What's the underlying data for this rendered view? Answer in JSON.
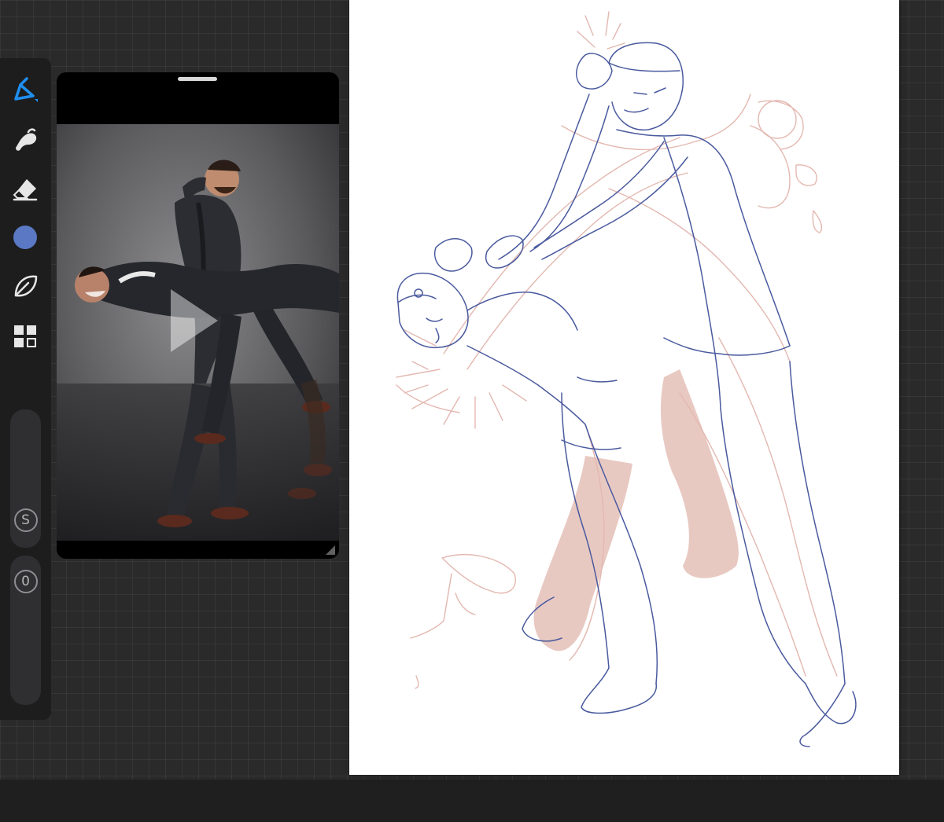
{
  "app": {
    "accent_color": "#1f8ff0",
    "current_color": "#5a78c4",
    "ink_blue": "#4a5a9e",
    "sketch_pink": "#e3b8b0"
  },
  "sidebar": {
    "tools": [
      {
        "name": "brush",
        "icon": "brush-icon",
        "active": true
      },
      {
        "name": "smudge",
        "icon": "smudge-icon",
        "active": false
      },
      {
        "name": "eraser",
        "icon": "eraser-icon",
        "active": false
      },
      {
        "name": "color",
        "icon": "color-swatch",
        "active": false
      },
      {
        "name": "brush-library",
        "icon": "leaf-icon",
        "active": false
      },
      {
        "name": "layers",
        "icon": "layers-icon",
        "active": false
      }
    ],
    "brush_size_button": "S",
    "opacity_button": "0"
  },
  "reference": {
    "photo": "reference-photo-two-men-in-suits-fighting"
  }
}
